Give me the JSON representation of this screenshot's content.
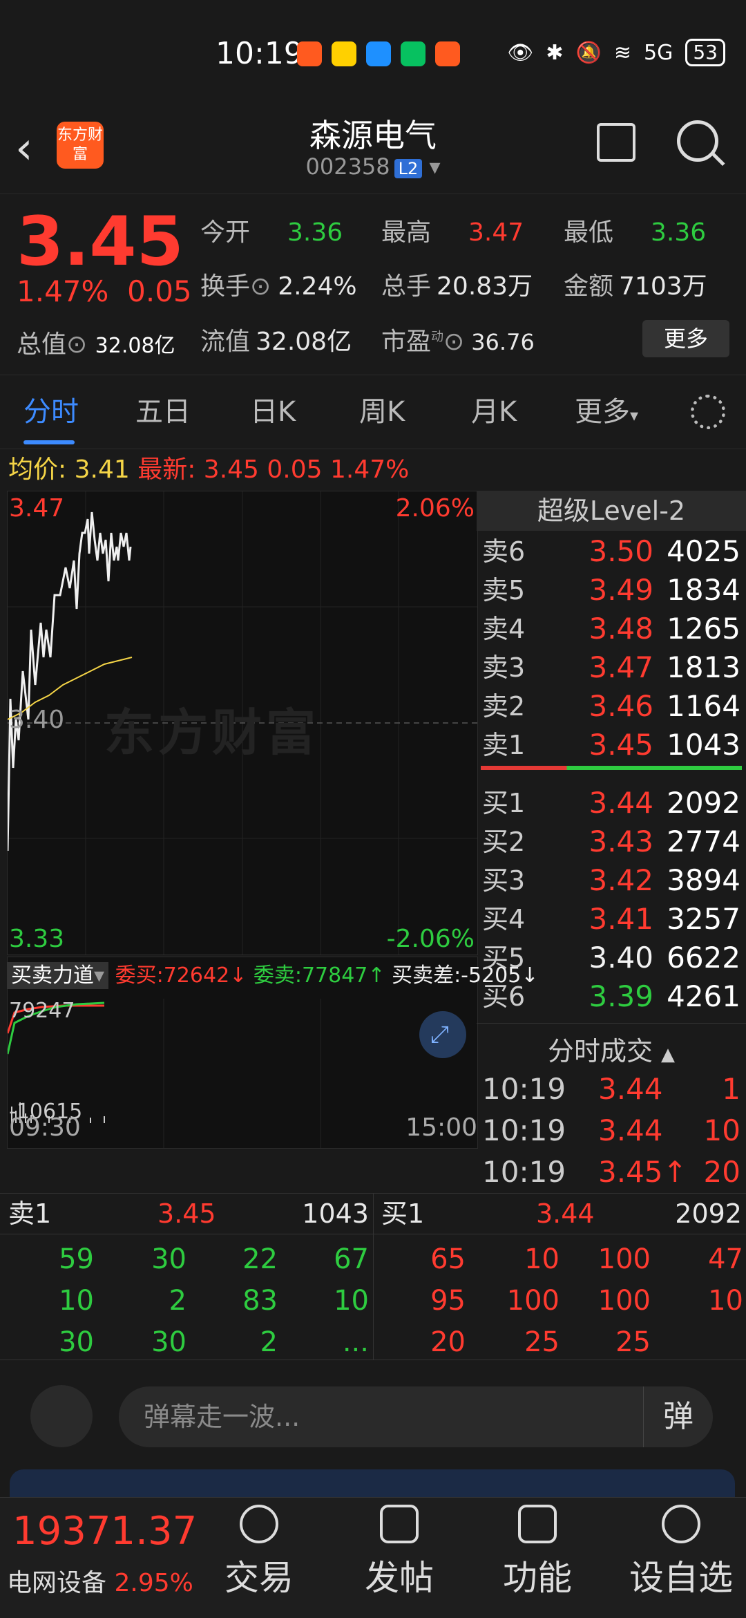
{
  "status": {
    "time": "10:19",
    "battery": "53",
    "signal": "5G"
  },
  "header": {
    "logo": "东方财富",
    "name": "森源电气",
    "code": "002358",
    "level": "L2"
  },
  "quote": {
    "price": "3.45",
    "pct": "1.47%",
    "chg": "0.05",
    "zz_label": "总值",
    "zz_value": "32.08亿",
    "fields": [
      {
        "k": "今开",
        "v": "3.36",
        "c": "green"
      },
      {
        "k": "最高",
        "v": "3.47",
        "c": "red"
      },
      {
        "k": "最低",
        "v": "3.36",
        "c": "green"
      },
      {
        "k": "换手",
        "v": "2.24%",
        "c": "white"
      },
      {
        "k": "总手",
        "v": "20.83万",
        "c": "white"
      },
      {
        "k": "金额",
        "v": "7103万",
        "c": "white"
      },
      {
        "k": "流值",
        "v": "32.08亿",
        "c": "white"
      },
      {
        "k": "市盈",
        "v": "36.76",
        "c": "white"
      }
    ],
    "pe_sup": "动",
    "more": "更多"
  },
  "tabs": [
    "分时",
    "五日",
    "日K",
    "周K",
    "月K",
    "更多"
  ],
  "avg": {
    "avg_label": "均价:",
    "avg": "3.41",
    "latest_label": "最新:",
    "latest": "3.45",
    "chg": "0.05",
    "pct": "1.47%"
  },
  "chart": {
    "top": "3.47",
    "top_pct": "2.06%",
    "mid": "3.40",
    "bottom": "3.33",
    "bottom_pct": "-2.06%",
    "watermark": "东方财富"
  },
  "flow": {
    "sel": "买卖力道",
    "wm": "委买:72642↓",
    "ws": "委卖:77847↑",
    "diff": "买卖差:-5205↓",
    "max": "79247",
    "min": "-10615",
    "t_start": "09:30",
    "t_end": "15:00"
  },
  "level2": {
    "title": "超级Level-2",
    "sells": [
      {
        "l": "卖6",
        "p": "3.50",
        "v": "4025"
      },
      {
        "l": "卖5",
        "p": "3.49",
        "v": "1834"
      },
      {
        "l": "卖4",
        "p": "3.48",
        "v": "1265"
      },
      {
        "l": "卖3",
        "p": "3.47",
        "v": "1813"
      },
      {
        "l": "卖2",
        "p": "3.46",
        "v": "1164"
      },
      {
        "l": "卖1",
        "p": "3.45",
        "v": "1043"
      }
    ],
    "buys": [
      {
        "l": "买1",
        "p": "3.44",
        "v": "2092",
        "c": "red"
      },
      {
        "l": "买2",
        "p": "3.43",
        "v": "2774",
        "c": "red"
      },
      {
        "l": "买3",
        "p": "3.42",
        "v": "3894",
        "c": "red"
      },
      {
        "l": "买4",
        "p": "3.41",
        "v": "3257",
        "c": "red"
      },
      {
        "l": "买5",
        "p": "3.40",
        "v": "6622",
        "c": "white"
      },
      {
        "l": "买6",
        "p": "3.39",
        "v": "4261",
        "c": "green"
      }
    ],
    "fscj": "分时成交",
    "trades": [
      {
        "t": "10:19",
        "p": "3.44",
        "v": "1"
      },
      {
        "t": "10:19",
        "p": "3.44",
        "v": "10"
      },
      {
        "t": "10:19",
        "p": "3.45↑",
        "v": "20"
      }
    ]
  },
  "queue": {
    "sell": {
      "label": "卖1",
      "price": "3.45",
      "vol": "1043",
      "cells": [
        "59",
        "30",
        "22",
        "67",
        "10",
        "2",
        "83",
        "10",
        "30",
        "30",
        "2",
        "..."
      ]
    },
    "buy": {
      "label": "买1",
      "price": "3.44",
      "vol": "2092",
      "cells": [
        "65",
        "10",
        "100",
        "47",
        "95",
        "100",
        "100",
        "10",
        "20",
        "25",
        "25",
        ""
      ]
    }
  },
  "comment": {
    "placeholder": "弹幕走一波...",
    "btn": "弹"
  },
  "nav": {
    "index": "19371.37",
    "sector": "电网设备",
    "sector_pct": "2.95%",
    "items": [
      "交易",
      "发帖",
      "功能",
      "设自选"
    ]
  }
}
